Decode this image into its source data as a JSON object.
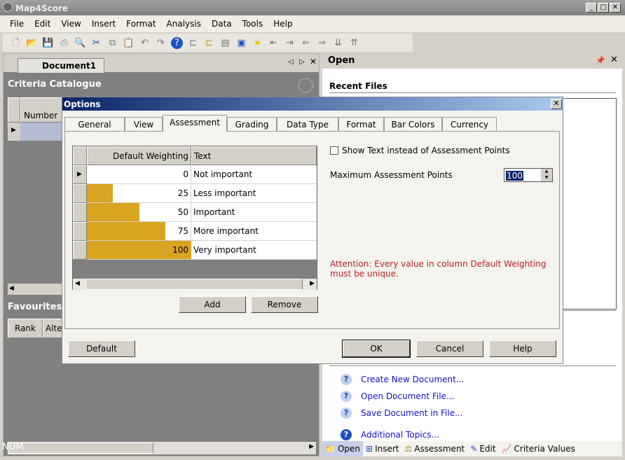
{
  "app": {
    "title": "Map4Score"
  },
  "menu": [
    "File",
    "Edit",
    "View",
    "Insert",
    "Format",
    "Analysis",
    "Data",
    "Tools",
    "Help"
  ],
  "document_tab": "Document1",
  "left": {
    "criteria_title": "Criteria Catalogue",
    "criteria_col": "Number",
    "favourites_title": "Favourites s",
    "fav_cols": [
      "Rank",
      "Alte"
    ],
    "status": "NUM"
  },
  "right": {
    "header": "Open",
    "recent_files": "Recent Files",
    "links": [
      "Create New Document...",
      "Open Document File...",
      "Save Document in File...",
      "Additional Topics..."
    ],
    "bottom_tabs": [
      "Open",
      "Insert",
      "Assessment",
      "Edit",
      "Criteria Values"
    ]
  },
  "dialog": {
    "title": "Options",
    "tabs": [
      "General",
      "View",
      "Assessment",
      "Grading",
      "Data Type",
      "Format",
      "Bar Colors",
      "Currency"
    ],
    "active_tab": "Assessment",
    "grid": {
      "columns": [
        "Default Weighting",
        "Text"
      ],
      "rows": [
        {
          "weight": "0",
          "text": "Not important",
          "fraction": 0
        },
        {
          "weight": "25",
          "text": "Less important",
          "fraction": 0.25
        },
        {
          "weight": "50",
          "text": "Important",
          "fraction": 0.5
        },
        {
          "weight": "75",
          "text": "More important",
          "fraction": 0.75
        },
        {
          "weight": "100",
          "text": "Very important",
          "fraction": 1
        }
      ]
    },
    "bar_color": "#d9a520",
    "add": "Add",
    "remove": "Remove",
    "show_text_label": "Show Text instead of Assessment Points",
    "show_text_checked": false,
    "max_points_label": "Maximum Assessment Points",
    "max_points": "100",
    "attention": "Attention: Every value in column Default Weighting must be unique.",
    "buttons": {
      "default": "Default",
      "ok": "OK",
      "cancel": "Cancel",
      "help": "Help"
    }
  }
}
